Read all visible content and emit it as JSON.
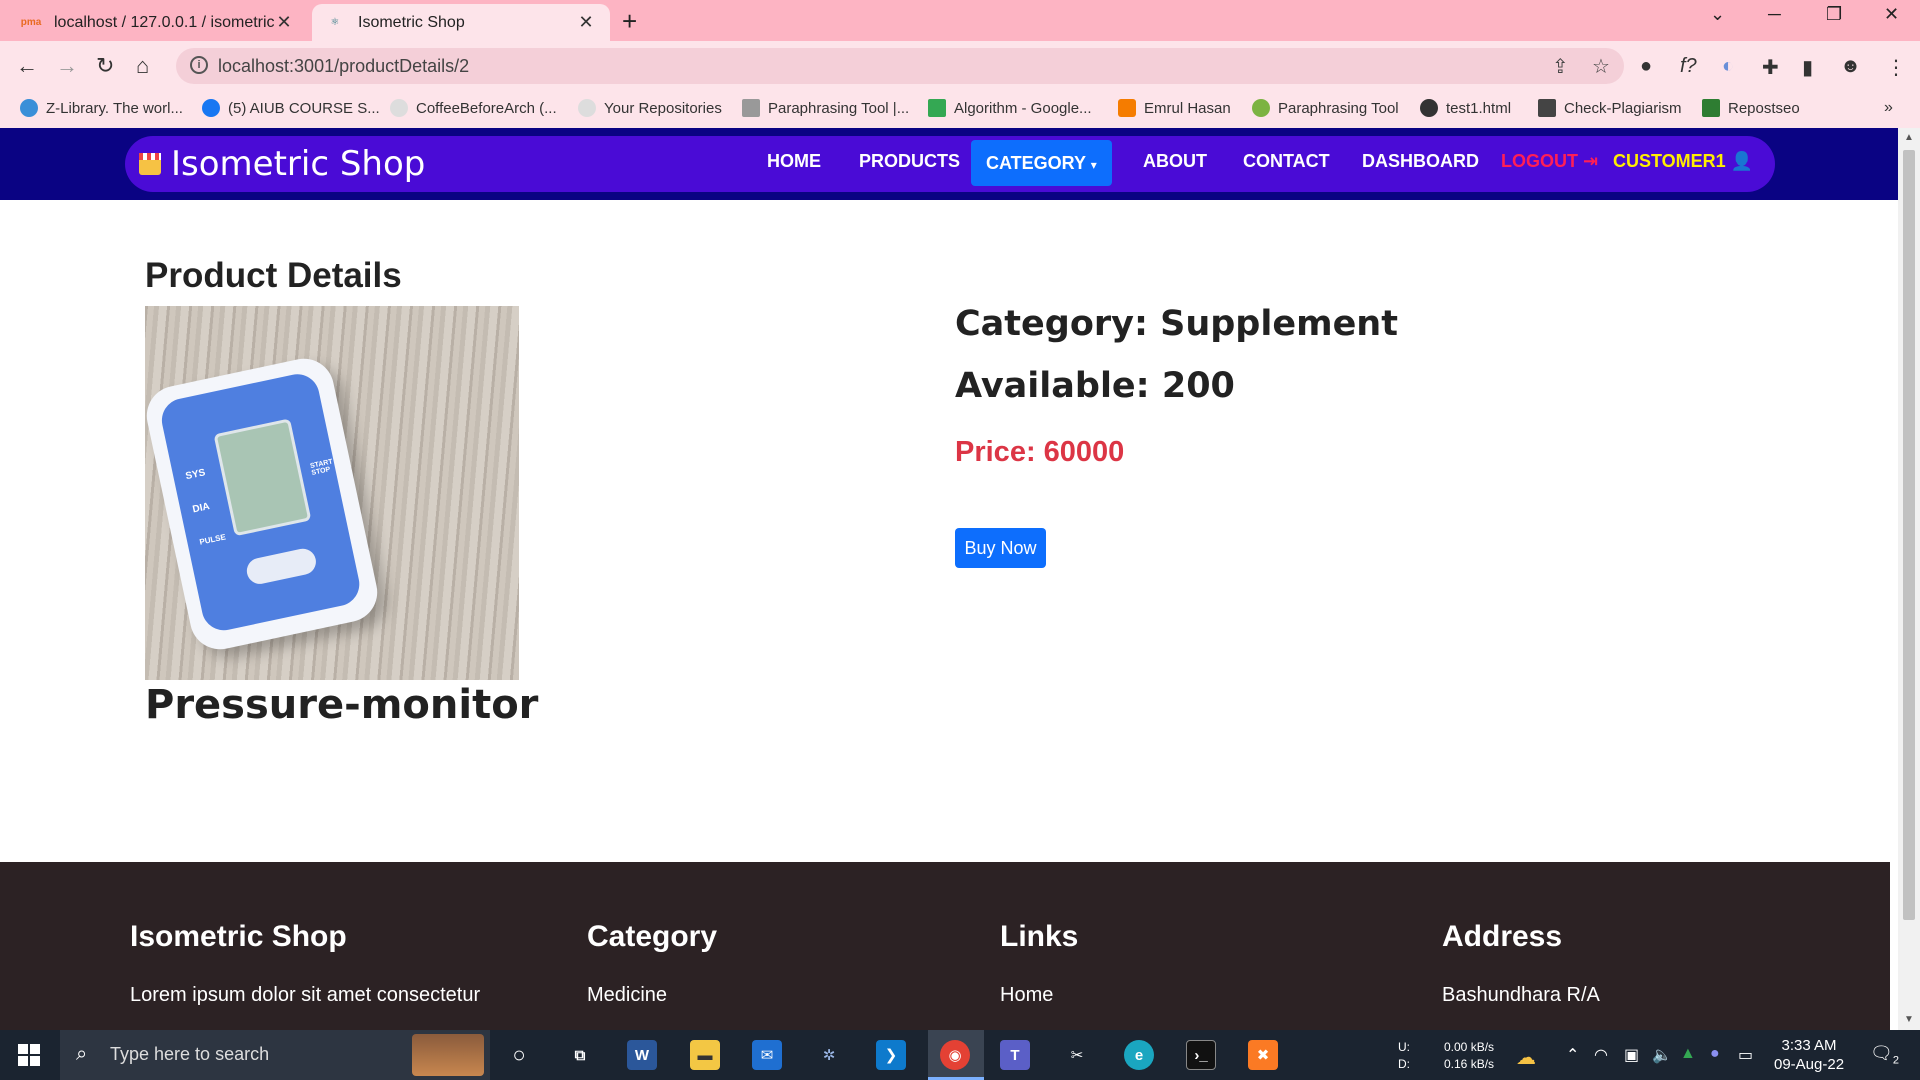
{
  "browser": {
    "tabs": [
      {
        "title": "localhost / 127.0.0.1 / isometric_",
        "favicon": "pma",
        "active": false
      },
      {
        "title": "Isometric Shop",
        "favicon": "react-icon",
        "active": true
      }
    ],
    "url": "localhost:3001/productDetails/2",
    "bookmarks": [
      {
        "label": "Z-Library. The worl...",
        "color": "#3a8fd8"
      },
      {
        "label": "(5) AIUB COURSE S...",
        "color": "#1877f2"
      },
      {
        "label": "CoffeeBeforeArch (...",
        "color": "#cccccc"
      },
      {
        "label": "Your Repositories",
        "color": "#cccccc"
      },
      {
        "label": "Paraphrasing Tool |...",
        "color": "#888888"
      },
      {
        "label": "Algorithm - Google...",
        "color": "#34a853"
      },
      {
        "label": "Emrul Hasan",
        "color": "#f57c00"
      },
      {
        "label": "Paraphrasing Tool",
        "color": "#7cb342"
      },
      {
        "label": "test1.html",
        "color": "#333333"
      },
      {
        "label": "Check-Plagiarism",
        "color": "#444444"
      },
      {
        "label": "Repostseo",
        "color": "#2e7d32"
      }
    ]
  },
  "site": {
    "brand": "Isometric Shop",
    "nav": {
      "home": "HOME",
      "products": "PRODUCTS",
      "category": "CATEGORY",
      "about": "ABOUT",
      "contact": "CONTACT",
      "dashboard": "DASHBOARD",
      "logout": "LOGOUT",
      "customer": "CUSTOMER1"
    }
  },
  "product": {
    "section_title": "Product Details",
    "name": "Pressure-monitor",
    "category": "Category: Supplement",
    "available": "Available: 200",
    "price": "Price: 60000",
    "buy_label": "Buy Now",
    "image_labels": {
      "sys": "SYS",
      "dia": "DIA",
      "pulse": "PULSE",
      "start": "START STOP"
    }
  },
  "footer": {
    "col1": {
      "title": "Isometric Shop",
      "text": "Lorem ipsum dolor sit amet consectetur"
    },
    "col2": {
      "title": "Category",
      "item": "Medicine"
    },
    "col3": {
      "title": "Links",
      "item": "Home"
    },
    "col4": {
      "title": "Address",
      "item": "Bashundhara R/A"
    }
  },
  "taskbar": {
    "search_placeholder": "Type here to search",
    "net_up_label": "U:",
    "net_down_label": "D:",
    "net_up": "0.00 kB/s",
    "net_down": "0.16 kB/s",
    "time": "3:33 AM",
    "date": "09-Aug-22",
    "notifications": "2"
  },
  "colors": {
    "header_bg": "#0a0383",
    "nav_bg": "#4a0bd6",
    "category_active": "#0d6efd",
    "logout": "#ff1e56",
    "customer": "#ffee00",
    "price": "#dc3545",
    "footer_bg": "#2c2224"
  }
}
